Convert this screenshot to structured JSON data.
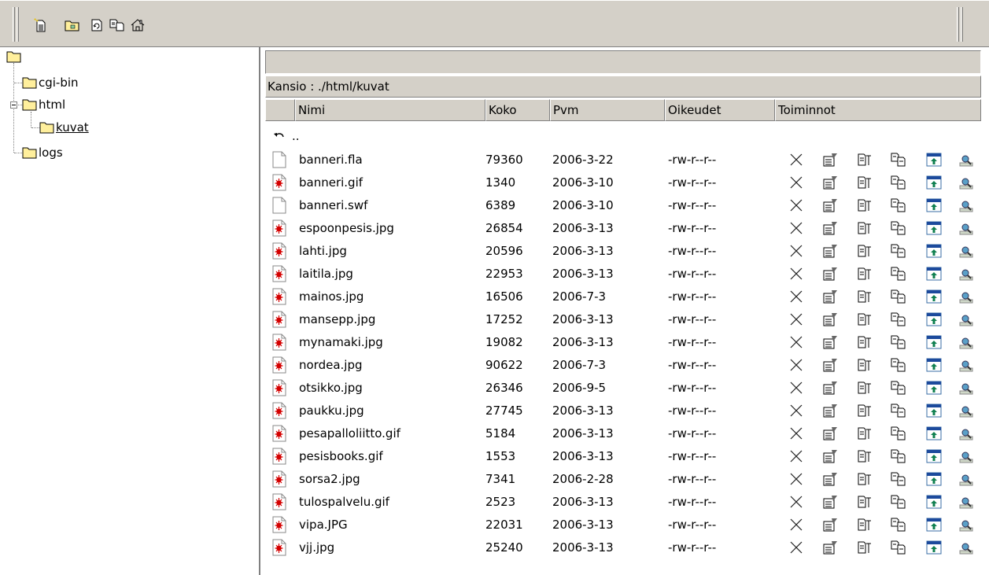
{
  "toolbar": {
    "buttons": [
      {
        "icon": "new-file-icon"
      },
      {
        "icon": "new-folder-icon"
      },
      {
        "icon": "refresh-icon"
      },
      {
        "icon": "copy-icon"
      },
      {
        "icon": "home-icon"
      }
    ]
  },
  "tree": {
    "nodes": [
      {
        "label": "cgi-bin"
      },
      {
        "label": "html"
      },
      {
        "label": "kuvat"
      },
      {
        "label": "logs"
      }
    ]
  },
  "path": {
    "text": "Kansio : ./html/kuvat"
  },
  "columns": {
    "name": "Nimi",
    "size": "Koko",
    "date": "Pvm",
    "perms": "Oikeudet",
    "actions": "Toiminnot"
  },
  "parent": {
    "label": ".."
  },
  "files": [
    {
      "name": "banneri.fla",
      "size": "79360",
      "date": "2006-3-22",
      "perms": "-rw-r--r--",
      "type": "doc"
    },
    {
      "name": "banneri.gif",
      "size": "1340",
      "date": "2006-3-10",
      "perms": "-rw-r--r--",
      "type": "img"
    },
    {
      "name": "banneri.swf",
      "size": "6389",
      "date": "2006-3-10",
      "perms": "-rw-r--r--",
      "type": "doc"
    },
    {
      "name": "espoonpesis.jpg",
      "size": "26854",
      "date": "2006-3-13",
      "perms": "-rw-r--r--",
      "type": "img"
    },
    {
      "name": "lahti.jpg",
      "size": "20596",
      "date": "2006-3-13",
      "perms": "-rw-r--r--",
      "type": "img"
    },
    {
      "name": "laitila.jpg",
      "size": "22953",
      "date": "2006-3-13",
      "perms": "-rw-r--r--",
      "type": "img"
    },
    {
      "name": "mainos.jpg",
      "size": "16506",
      "date": "2006-7-3",
      "perms": "-rw-r--r--",
      "type": "img"
    },
    {
      "name": "mansepp.jpg",
      "size": "17252",
      "date": "2006-3-13",
      "perms": "-rw-r--r--",
      "type": "img"
    },
    {
      "name": "mynamaki.jpg",
      "size": "19082",
      "date": "2006-3-13",
      "perms": "-rw-r--r--",
      "type": "img"
    },
    {
      "name": "nordea.jpg",
      "size": "90622",
      "date": "2006-7-3",
      "perms": "-rw-r--r--",
      "type": "img"
    },
    {
      "name": "otsikko.jpg",
      "size": "26346",
      "date": "2006-9-5",
      "perms": "-rw-r--r--",
      "type": "img"
    },
    {
      "name": "paukku.jpg",
      "size": "27745",
      "date": "2006-3-13",
      "perms": "-rw-r--r--",
      "type": "img"
    },
    {
      "name": "pesapalloliitto.gif",
      "size": "5184",
      "date": "2006-3-13",
      "perms": "-rw-r--r--",
      "type": "img"
    },
    {
      "name": "pesisbooks.gif",
      "size": "1553",
      "date": "2006-3-13",
      "perms": "-rw-r--r--",
      "type": "img"
    },
    {
      "name": "sorsa2.jpg",
      "size": "7341",
      "date": "2006-2-28",
      "perms": "-rw-r--r--",
      "type": "img"
    },
    {
      "name": "tulospalvelu.gif",
      "size": "2523",
      "date": "2006-3-13",
      "perms": "-rw-r--r--",
      "type": "img"
    },
    {
      "name": "vipa.JPG",
      "size": "22031",
      "date": "2006-3-13",
      "perms": "-rw-r--r--",
      "type": "img"
    },
    {
      "name": "vjj.jpg",
      "size": "25240",
      "date": "2006-3-13",
      "perms": "-rw-r--r--",
      "type": "img"
    }
  ],
  "row_actions": [
    "delete-icon",
    "properties-icon",
    "rename-icon",
    "copy-icon",
    "upload-icon",
    "view-icon"
  ],
  "colors": {
    "chrome": "#d4d0c8",
    "folder": "#ffef9c",
    "image_mark": "#d40000",
    "upload": "#0f7f4f"
  }
}
